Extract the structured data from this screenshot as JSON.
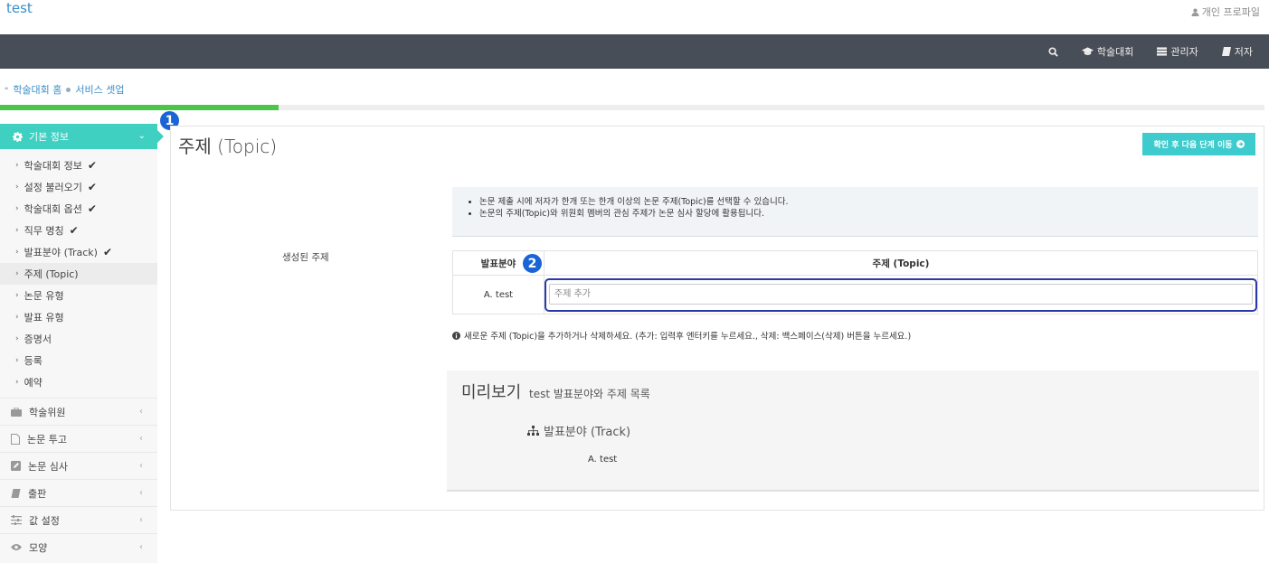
{
  "app": {
    "title": "test",
    "profile_label": "개인 프로파일"
  },
  "nav": {
    "items": [
      {
        "icon": "search-icon",
        "label": ""
      },
      {
        "icon": "graduation-cap-icon",
        "label": "학술대회"
      },
      {
        "icon": "server-icon",
        "label": "관리자"
      },
      {
        "icon": "book-icon",
        "label": "저자"
      }
    ]
  },
  "breadcrumb": {
    "home": "학술대회 홈",
    "current": "서비스 셋업"
  },
  "progress": {
    "percent": 22
  },
  "sidebar": {
    "active_section": "기본 정보",
    "sub_items": [
      {
        "label": "학술대회 정보",
        "done": true
      },
      {
        "label": "설정 불러오기",
        "done": true
      },
      {
        "label": "학술대회 옵션",
        "done": true
      },
      {
        "label": "직무 명칭",
        "done": true
      },
      {
        "label": "발표분야 (Track)",
        "done": true
      },
      {
        "label": "주제 (Topic)",
        "done": false
      },
      {
        "label": "논문 유형",
        "done": false
      },
      {
        "label": "발표 유형",
        "done": false
      },
      {
        "label": "증명서",
        "done": false
      },
      {
        "label": "등록",
        "done": false
      },
      {
        "label": "예약",
        "done": false
      }
    ],
    "check_mark": "✔",
    "groups": [
      {
        "icon": "briefcase-icon",
        "label": "학술위원"
      },
      {
        "icon": "file-icon",
        "label": "논문 투고"
      },
      {
        "icon": "edit-icon",
        "label": "논문 심사"
      },
      {
        "icon": "book-icon",
        "label": "출판"
      },
      {
        "icon": "sliders-icon",
        "label": "값 설정"
      },
      {
        "icon": "eye-icon",
        "label": "모양"
      }
    ]
  },
  "badges": {
    "one": "1",
    "two": "2"
  },
  "main": {
    "title": "주제 (Topic)",
    "next_button": "확인 후 다음 단계 이동",
    "info_lines": [
      "논문 제출 시에 저자가 한개 또는 한개 이상의 논문 주제(Topic)를 선택할 수 있습니다.",
      "논문의 주제(Topic)와 위원회 멤버의 관심 주제가 논문 심사 할당에 활용됩니다."
    ],
    "field_label": "생성된 주제",
    "table": {
      "col_track": "발표분야",
      "col_topic": "주제 (Topic)",
      "row_track": "A. test",
      "input_placeholder": "주제 추가"
    },
    "help_text": "새로운 주제 (Topic)을 추가하거나 삭제하세요. (추가: 입력후 엔터키를 누르세요., 삭제: 백스페이스(삭제) 버튼을 누르세요.)",
    "preview": {
      "title": "미리보기",
      "subtitle": "test 발표분야와 주제 목록",
      "track_heading": "발표분야 (Track)",
      "track_item": "A. test"
    }
  }
}
